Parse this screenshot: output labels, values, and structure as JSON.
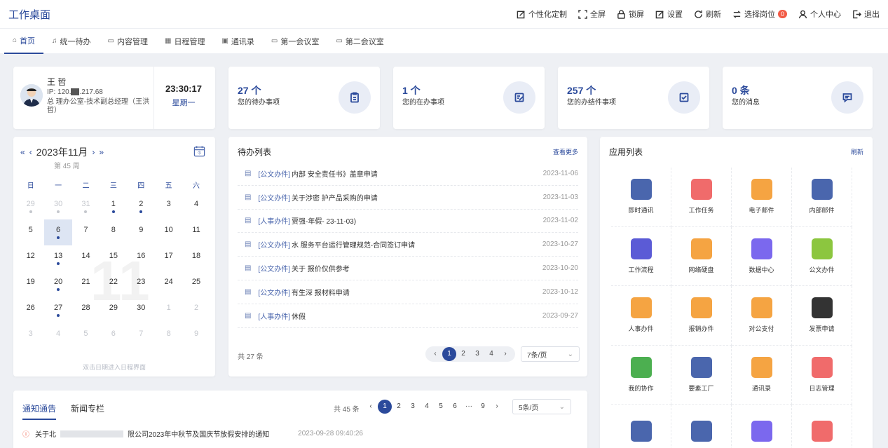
{
  "header": {
    "title": "工作桌面",
    "actions": [
      {
        "label": "个性化定制",
        "icon": "customize-icon"
      },
      {
        "label": "全屏",
        "icon": "fullscreen-icon"
      },
      {
        "label": "锁屏",
        "icon": "lock-icon"
      },
      {
        "label": "设置",
        "icon": "settings-icon"
      },
      {
        "label": "刷新",
        "icon": "refresh-icon"
      },
      {
        "label": "选择岗位",
        "icon": "switch-post-icon",
        "badge": "0"
      },
      {
        "label": "个人中心",
        "icon": "user-icon"
      },
      {
        "label": "退出",
        "icon": "logout-icon"
      }
    ]
  },
  "tabs": [
    {
      "label": "首页",
      "icon": "home-icon"
    },
    {
      "label": "统一待办",
      "icon": "bell-icon"
    },
    {
      "label": "内容管理",
      "icon": "content-icon"
    },
    {
      "label": "日程管理",
      "icon": "calendar-icon"
    },
    {
      "label": "通讯录",
      "icon": "contacts-icon"
    },
    {
      "label": "第一会议室",
      "icon": "monitor-icon"
    },
    {
      "label": "第二会议室",
      "icon": "monitor-icon"
    }
  ],
  "profile": {
    "name": "王 哲",
    "ip": "IP: 120.",
    "ip_tail": ".217.68",
    "dept": "总    理办公室-技术副总经理（王洪哲）",
    "time": "23:30:17",
    "weekday": "星期一"
  },
  "stats": [
    {
      "value": "27 个",
      "label": "您的待办事项",
      "icon": "clipboard-icon"
    },
    {
      "value": "1 个",
      "label": "您的在办事项",
      "icon": "edit-doc-icon"
    },
    {
      "value": "257 个",
      "label": "您的办结件事项",
      "icon": "check-box-icon"
    },
    {
      "value": "0 条",
      "label": "您的消息",
      "icon": "message-icon"
    }
  ],
  "calendar": {
    "title": "2023年11月",
    "week": "第 45 周",
    "weekdays": [
      "日",
      "一",
      "二",
      "三",
      "四",
      "五",
      "六"
    ],
    "big_day": "11",
    "hint": "双击日期进入日程界面",
    "rows": [
      [
        [
          "29",
          "m",
          "g"
        ],
        [
          "30",
          "m",
          "g"
        ],
        [
          "31",
          "m",
          "g"
        ],
        [
          "1",
          "",
          "b"
        ],
        [
          "2",
          "",
          "b"
        ],
        [
          "3",
          "",
          ""
        ],
        [
          "4",
          "",
          ""
        ]
      ],
      [
        [
          "5",
          "",
          ""
        ],
        [
          "6",
          "s",
          "b"
        ],
        [
          "7",
          "",
          ""
        ],
        [
          "8",
          "",
          ""
        ],
        [
          "9",
          "",
          ""
        ],
        [
          "10",
          "",
          ""
        ],
        [
          "11",
          "",
          ""
        ]
      ],
      [
        [
          "12",
          "",
          ""
        ],
        [
          "13",
          "",
          "b"
        ],
        [
          "14",
          "",
          ""
        ],
        [
          "15",
          "",
          ""
        ],
        [
          "16",
          "",
          ""
        ],
        [
          "17",
          "",
          ""
        ],
        [
          "18",
          "",
          ""
        ]
      ],
      [
        [
          "19",
          "",
          ""
        ],
        [
          "20",
          "",
          "b"
        ],
        [
          "21",
          "",
          ""
        ],
        [
          "22",
          "",
          ""
        ],
        [
          "23",
          "",
          ""
        ],
        [
          "24",
          "",
          ""
        ],
        [
          "25",
          "",
          ""
        ]
      ],
      [
        [
          "26",
          "",
          ""
        ],
        [
          "27",
          "",
          "b"
        ],
        [
          "28",
          "",
          ""
        ],
        [
          "29",
          "",
          ""
        ],
        [
          "30",
          "",
          ""
        ],
        [
          "1",
          "m",
          ""
        ],
        [
          "2",
          "m",
          ""
        ]
      ],
      [
        [
          "3",
          "m",
          ""
        ],
        [
          "4",
          "m",
          ""
        ],
        [
          "5",
          "m",
          ""
        ],
        [
          "6",
          "m",
          ""
        ],
        [
          "7",
          "m",
          ""
        ],
        [
          "8",
          "m",
          ""
        ],
        [
          "9",
          "m",
          ""
        ]
      ]
    ]
  },
  "todo": {
    "title": "待办列表",
    "more": "查看更多",
    "items": [
      {
        "cat": "[公文办件]",
        "text": "内部            安全责任书》盖章申请",
        "date": "2023-11-06"
      },
      {
        "cat": "[公文办件]",
        "text": "关于涉密              护产品采购的申请",
        "date": "2023-11-03"
      },
      {
        "cat": "[人事办件]",
        "text": "贾强-年假-            23-11-03)",
        "date": "2023-11-02"
      },
      {
        "cat": "[公文办件]",
        "text": "水        服务平台运行管理规范-合同签订申请",
        "date": "2023-10-27"
      },
      {
        "cat": "[公文办件]",
        "text": "关于              报价仅供参考",
        "date": "2023-10-20"
      },
      {
        "cat": "[公文办件]",
        "text": "有生深            报材料申请",
        "date": "2023-10-12"
      },
      {
        "cat": "[人事办件]",
        "text": "休假",
        "date": "2023-09-27"
      }
    ],
    "total": "共 27 条",
    "pages": [
      "1",
      "2",
      "3",
      "4"
    ],
    "per_page": "7条/页"
  },
  "apps_panel": {
    "title": "应用列表",
    "refresh": "刷新",
    "apps": [
      {
        "label": "即时通讯",
        "icon": "chat-icon",
        "color": "#4a66ad"
      },
      {
        "label": "工作任务",
        "icon": "task-icon",
        "color": "#f06b6b"
      },
      {
        "label": "电子邮件",
        "icon": "email-icon",
        "color": "#f5a442"
      },
      {
        "label": "内部邮件",
        "icon": "inbox-mail-icon",
        "color": "#4a66ad"
      },
      {
        "label": "工作流程",
        "icon": "workflow-icon",
        "color": "#5b5bd6"
      },
      {
        "label": "网络硬盘",
        "icon": "disk-icon",
        "color": "#f5a442"
      },
      {
        "label": "数据中心",
        "icon": "data-center-icon",
        "color": "#7b68ee"
      },
      {
        "label": "公文办件",
        "icon": "document-icon",
        "color": "#8cc63f"
      },
      {
        "label": "人事办件",
        "icon": "hr-icon",
        "color": "#f5a442"
      },
      {
        "label": "报销办件",
        "icon": "reimburse-icon",
        "color": "#f5a442"
      },
      {
        "label": "对公支付",
        "icon": "payment-icon",
        "color": "#f5a442"
      },
      {
        "label": "发票申请",
        "icon": "invoice-icon",
        "color": "#333333"
      },
      {
        "label": "我的协作",
        "icon": "handshake-icon",
        "color": "#4caf50"
      },
      {
        "label": "要素工厂",
        "icon": "factory-icon",
        "color": "#4a66ad"
      },
      {
        "label": "通讯录",
        "icon": "address-book-icon",
        "color": "#f5a442"
      },
      {
        "label": "日志管理",
        "icon": "log-icon",
        "color": "#f06b6b"
      },
      {
        "label": "",
        "icon": "team-icon",
        "color": "#4a66ad"
      },
      {
        "label": "",
        "icon": "ruler-icon",
        "color": "#4a66ad"
      },
      {
        "label": "",
        "icon": "presentation-icon",
        "color": "#7b68ee"
      },
      {
        "label": "",
        "icon": "stamp-icon",
        "color": "#f06b6b"
      }
    ]
  },
  "notices": {
    "tabs": [
      "通知通告",
      "新闻专栏"
    ],
    "total": "共 45 条",
    "pages": [
      "1",
      "2",
      "3",
      "4",
      "5",
      "6",
      "···",
      "9"
    ],
    "per_page": "5条/页",
    "items": [
      {
        "prefix": "关于北",
        "text": "限公司2023年中秋节及国庆节放假安排的通知",
        "date": "2023-09-28 09:40:26"
      }
    ]
  },
  "colors": {
    "accent": "#2b4a9b",
    "badge": "#f25a45",
    "background": "#eef0f4"
  }
}
